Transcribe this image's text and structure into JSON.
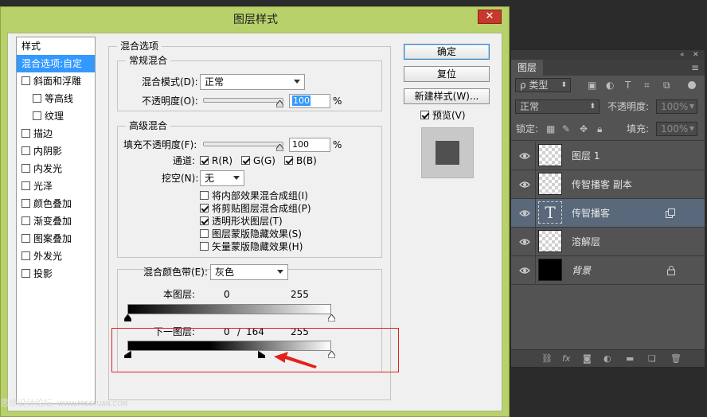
{
  "dialog": {
    "title": "图层样式",
    "close": "✕"
  },
  "style_list": {
    "header": "样式",
    "items": [
      {
        "label": "混合选项:自定",
        "checked": null,
        "active": true
      },
      {
        "label": "斜面和浮雕",
        "checked": false
      },
      {
        "label": "等高线",
        "checked": false,
        "indent": true
      },
      {
        "label": "纹理",
        "checked": false,
        "indent": true
      },
      {
        "label": "描边",
        "checked": false
      },
      {
        "label": "内阴影",
        "checked": false
      },
      {
        "label": "内发光",
        "checked": false
      },
      {
        "label": "光泽",
        "checked": false
      },
      {
        "label": "颜色叠加",
        "checked": false
      },
      {
        "label": "渐变叠加",
        "checked": false
      },
      {
        "label": "图案叠加",
        "checked": false
      },
      {
        "label": "外发光",
        "checked": false
      },
      {
        "label": "投影",
        "checked": false
      }
    ]
  },
  "blend_options": {
    "title": "混合选项",
    "general": {
      "title": "常规混合",
      "mode_label": "混合模式(D):",
      "mode_value": "正常",
      "opacity_label": "不透明度(O):",
      "opacity_value": "100",
      "unit": "%"
    },
    "advanced": {
      "title": "高级混合",
      "fill_label": "填充不透明度(F):",
      "fill_value": "100",
      "unit": "%",
      "channels_label": "通道:",
      "channel_r": "R(R)",
      "channel_g": "G(G)",
      "channel_b": "B(B)",
      "knockout_label": "挖空(N):",
      "knockout_value": "无",
      "options": [
        {
          "label": "将内部效果混合成组(I)",
          "checked": false
        },
        {
          "label": "将剪贴图层混合成组(P)",
          "checked": true
        },
        {
          "label": "透明形状图层(T)",
          "checked": true
        },
        {
          "label": "图层蒙版隐藏效果(S)",
          "checked": false
        },
        {
          "label": "矢量蒙版隐藏效果(H)",
          "checked": false
        }
      ]
    },
    "blend_if": {
      "label": "混合颜色带(E):",
      "value": "灰色",
      "this_layer_label": "本图层:",
      "this_layer_min": "0",
      "this_layer_max": "255",
      "underlying_label": "下一图层:",
      "underlying_min": "0",
      "underlying_sep": "/",
      "underlying_split": "164",
      "underlying_max": "255"
    }
  },
  "buttons": {
    "ok": "确定",
    "reset": "复位",
    "new_style": "新建样式(W)...",
    "preview_label": "预览(V)",
    "preview_checked": true
  },
  "layers_panel": {
    "tab": "图层",
    "filter_label": "ρ 类型",
    "blend_mode": "正常",
    "opacity_label": "不透明度:",
    "opacity_value": "100%",
    "lock_label": "锁定:",
    "fill_label": "填充:",
    "fill_value": "100%",
    "layers": [
      {
        "name": "图层 1",
        "thumb": "transparent"
      },
      {
        "name": "传智播客 副本",
        "thumb": "transparent"
      },
      {
        "name": "传智播客",
        "thumb": "text",
        "thumb_glyph": "T",
        "selected": true
      },
      {
        "name": "溶解层",
        "thumb": "transparent"
      },
      {
        "name": "背景",
        "thumb": "black",
        "locked": true
      }
    ],
    "bottom_icons": [
      "link-icon",
      "fx-icon",
      "mask-icon",
      "adjustment-icon",
      "folder-icon",
      "new-layer-icon",
      "trash-icon"
    ],
    "fx_text": "fx"
  },
  "watermark": {
    "text": "思缘设计论坛",
    "url": "WWW.MISSYUAN.COM"
  },
  "colors": {
    "dialog_frame": "#b9d16a",
    "selection": "#3399ff",
    "annotation": "#e0221b",
    "ps_panel": "#535353",
    "ps_selected_layer": "#59687a"
  }
}
